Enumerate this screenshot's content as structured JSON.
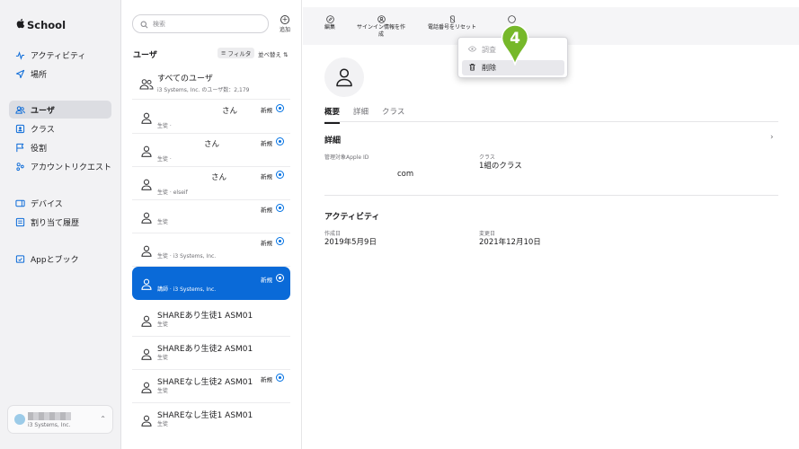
{
  "app": {
    "title": "School"
  },
  "sidebar": {
    "items": [
      {
        "label": "アクティビティ",
        "icon": "activity-icon"
      },
      {
        "label": "場所",
        "icon": "location-arrow-icon"
      },
      {
        "label": "ユーザ",
        "icon": "users-icon",
        "active": true
      },
      {
        "label": "クラス",
        "icon": "class-icon"
      },
      {
        "label": "役割",
        "icon": "flag-icon"
      },
      {
        "label": "アカウントリクエスト",
        "icon": "account-request-icon"
      },
      {
        "label": "デバイス",
        "icon": "device-icon"
      },
      {
        "label": "割り当て履歴",
        "icon": "history-icon"
      },
      {
        "label": "Appとブック",
        "icon": "apps-books-icon"
      }
    ],
    "org": {
      "subtitle": "i3 Systems, Inc."
    }
  },
  "userlist": {
    "search_placeholder": "検索",
    "add_label": "追加",
    "title": "ユーザ",
    "filter_label": "フィルタ",
    "sort_label": "並べ替え",
    "all_users": {
      "name": "すべてのユーザ",
      "sub": "i3 Systems, Inc. のユーザ数：2,179"
    },
    "rows": [
      {
        "name": "さん",
        "sub": "生徒 ·",
        "tag": "新規"
      },
      {
        "name": "さん",
        "sub": "生徒 ·",
        "tag": "新規"
      },
      {
        "name": "さん",
        "sub": "生徒 · elseif",
        "tag": "新規"
      },
      {
        "name": "",
        "sub": "生徒",
        "tag": "新規"
      },
      {
        "name": "",
        "sub": "生徒 · i3 Systems, Inc.",
        "tag": "新規"
      },
      {
        "name": "",
        "sub": "講師 · i3 Systems, Inc.",
        "tag": "新規",
        "selected": true
      },
      {
        "name": "SHAREあり生徒1 ASM01",
        "sub": "生徒",
        "tag": ""
      },
      {
        "name": "SHAREあり生徒2 ASM01",
        "sub": "生徒",
        "tag": ""
      },
      {
        "name": "SHAREなし生徒2 ASM01",
        "sub": "生徒",
        "tag": "新規"
      },
      {
        "name": "SHAREなし生徒1 ASM01",
        "sub": "生徒",
        "tag": ""
      }
    ]
  },
  "toolbar": {
    "edit": "編集",
    "signin_line1": "サインイン情報を作",
    "signin_line2": "成",
    "reset_phone": "電話番号をリセット"
  },
  "popup": {
    "inspect": "調査",
    "delete": "削除",
    "step_number": "4",
    "accent_color": "#76b82a"
  },
  "detail": {
    "tabs": [
      "概要",
      "詳細",
      "クラス"
    ],
    "details_title": "詳細",
    "managed_id_label": "管理対象Apple ID",
    "managed_id_value": "com",
    "class_label": "クラス",
    "class_value": "1組のクラス",
    "activity_title": "アクティビティ",
    "created_label": "作成日",
    "created_value": "2019年5月9日",
    "modified_label": "変更日",
    "modified_value": "2021年12月10日"
  },
  "colors": {
    "selection": "#0a6ad8",
    "sidebar_bg": "#f2f2f4"
  }
}
